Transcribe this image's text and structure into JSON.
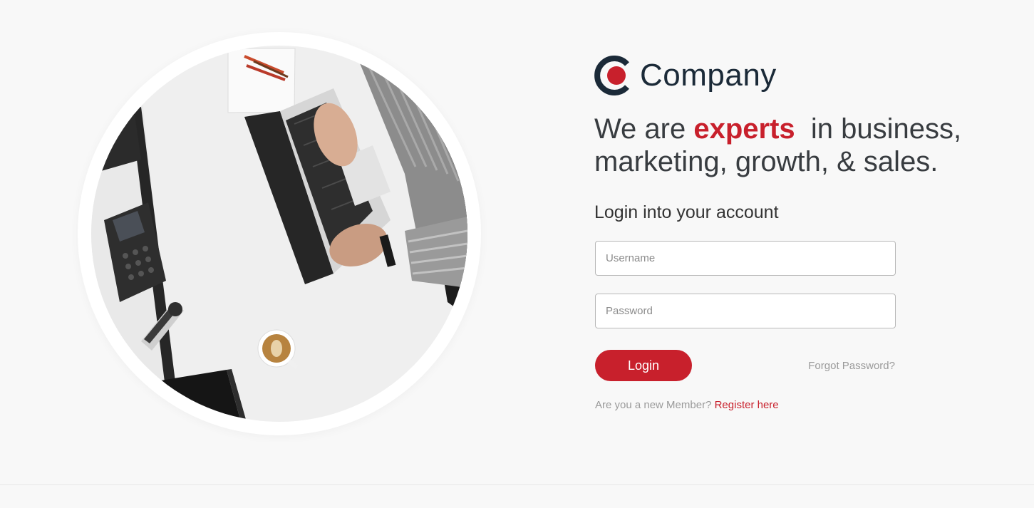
{
  "brand": {
    "name": "Company",
    "colors": {
      "accent": "#c8202c",
      "dark": "#1b2a38",
      "text": "#383c40",
      "muted": "#9a9a9a"
    }
  },
  "hero": {
    "headline_prefix": "We are",
    "headline_accent": "experts",
    "headline_line1_suffix": "in business,",
    "headline_line2": "marketing, growth, & sales.",
    "image_icon": "office-desk-photo"
  },
  "login": {
    "title": "Login into your account",
    "username_placeholder": "Username",
    "password_placeholder": "Password",
    "login_label": "Login",
    "forgot_label": "Forgot Password?",
    "register_prompt": "Are you a new Member?",
    "register_label": "Register here"
  }
}
